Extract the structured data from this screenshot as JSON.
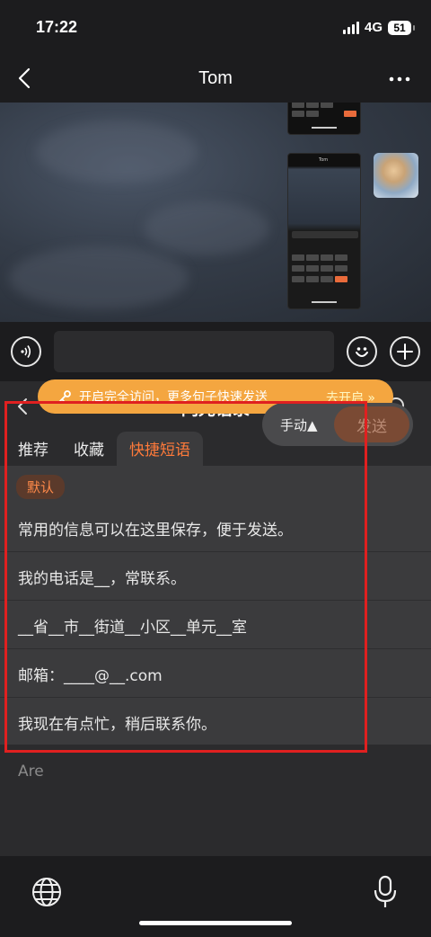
{
  "status_bar": {
    "time": "17:22",
    "network": "4G",
    "battery": "51"
  },
  "nav": {
    "title": "Tom",
    "back_icon": "chevron-left-icon",
    "more_icon": "more-dots-icon"
  },
  "input_bar": {
    "voice_icon": "voice-icon",
    "emoji_icon": "emoji-icon",
    "add_icon": "plus-icon"
  },
  "panel": {
    "title": "闪光语录",
    "tabs": [
      "推荐",
      "收藏",
      "快捷短语"
    ],
    "active_tab": "快捷短语",
    "badge": "默认",
    "phrases": [
      "常用的信息可以在这里保存，便于发送。",
      "我的电话是__，常联系。",
      "__省__市__街道__小区__单元__室",
      "邮箱：____@__.com",
      "我现在有点忙，稍后联系你。"
    ],
    "suggestion_text": "Are",
    "banner_text": "开启完全访问，更多句子快速发送",
    "banner_link": "去开启 »",
    "mode_label": "手动▲",
    "send_label": "发送"
  },
  "colors": {
    "accent": "#ff7a3a",
    "highlight": "#e02020",
    "banner": "#f4a640"
  }
}
